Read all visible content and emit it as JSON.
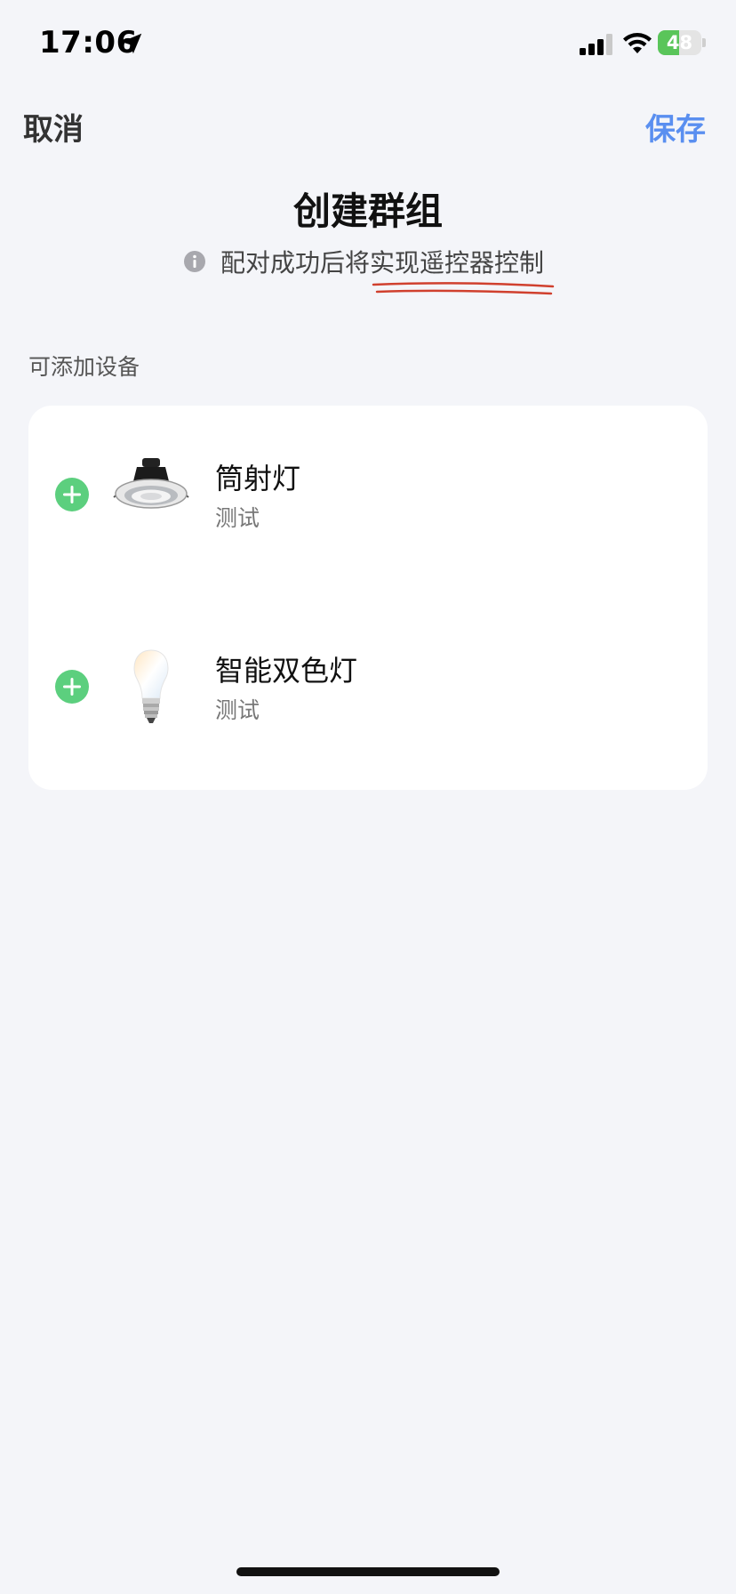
{
  "status_bar": {
    "time": "17:06",
    "battery_text": "48",
    "battery_level": 0.48,
    "icons": [
      "location-arrow-icon",
      "cellular-signal-icon",
      "wifi-icon",
      "battery-charging-icon"
    ]
  },
  "nav": {
    "cancel_label": "取消",
    "save_label": "保存",
    "save_color": "#5a8ff0"
  },
  "header": {
    "title": "创建群组",
    "hint": "配对成功后将实现遥控器控制",
    "hint_icon": "info-icon",
    "annotation_color": "#d0402e"
  },
  "section": {
    "label": "可添加设备"
  },
  "devices": [
    {
      "name": "筒射灯",
      "room": "测试",
      "image_icon": "downlight-icon",
      "action_icon": "add-circle-icon"
    },
    {
      "name": "智能双色灯",
      "room": "测试",
      "image_icon": "bulb-icon",
      "action_icon": "add-circle-icon"
    }
  ],
  "colors": {
    "background": "#f4f5f9",
    "card": "#ffffff",
    "add_green": "#5ccf7e"
  }
}
